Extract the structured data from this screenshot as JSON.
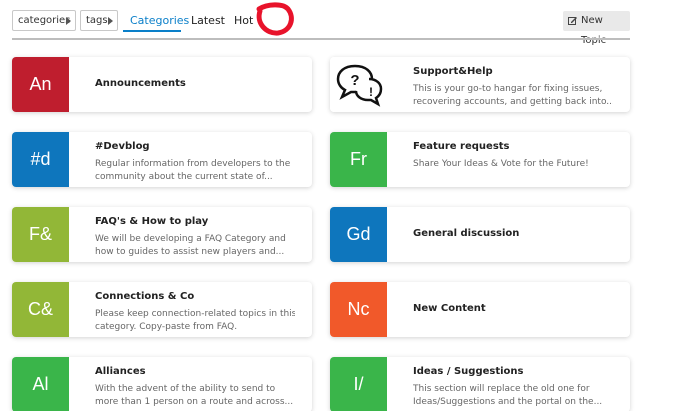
{
  "nav": {
    "categories_dropdown": "categories",
    "tags_dropdown": "tags",
    "tabs": [
      "Categories",
      "Latest",
      "Hot"
    ],
    "new_topic": "New Topic"
  },
  "categories": [
    {
      "abbr": "An",
      "color": "#bf1e2e",
      "title": "Announcements",
      "desc": []
    },
    {
      "abbr": "",
      "icon": "speech-bubbles-question-exclamation-icon",
      "color": "#ffffff",
      "title": "Support&Help",
      "desc": [
        "This is your go-to hangar for fixing issues,",
        "recovering accounts, and getting back into..."
      ]
    },
    {
      "abbr": "#d",
      "color": "#0e76bd",
      "title": "#Devblog",
      "desc": [
        "Regular information from developers to the",
        "community about the current state of..."
      ]
    },
    {
      "abbr": "Fr",
      "color": "#3ab54a",
      "title": "Feature requests",
      "desc": [
        "Share Your Ideas & Vote for the Future!"
      ]
    },
    {
      "abbr": "F&",
      "color": "#92b737",
      "title": "FAQ's & How to play",
      "desc": [
        "We will be developing a FAQ Category and",
        "how to guides to assist new players and..."
      ]
    },
    {
      "abbr": "Gd",
      "color": "#0e76bd",
      "title": "General discussion",
      "desc": []
    },
    {
      "abbr": "C&",
      "color": "#92b737",
      "title": "Connections & Co",
      "desc": [
        "Please keep connection-related topics in this",
        "category. Copy-paste from FAQ."
      ]
    },
    {
      "abbr": "Nc",
      "color": "#f1592a",
      "title": "New Content",
      "desc": []
    },
    {
      "abbr": "Al",
      "color": "#3ab54a",
      "title": "Alliances",
      "desc": [
        "With the advent of the ability to send to",
        "more than 1 person on a route and across..."
      ]
    },
    {
      "abbr": "I/",
      "color": "#3ab54a",
      "title": "Ideas / Suggestions",
      "desc": [
        "This section will replace the old one for",
        "Ideas/Suggestions and the portal on the..."
      ]
    }
  ]
}
